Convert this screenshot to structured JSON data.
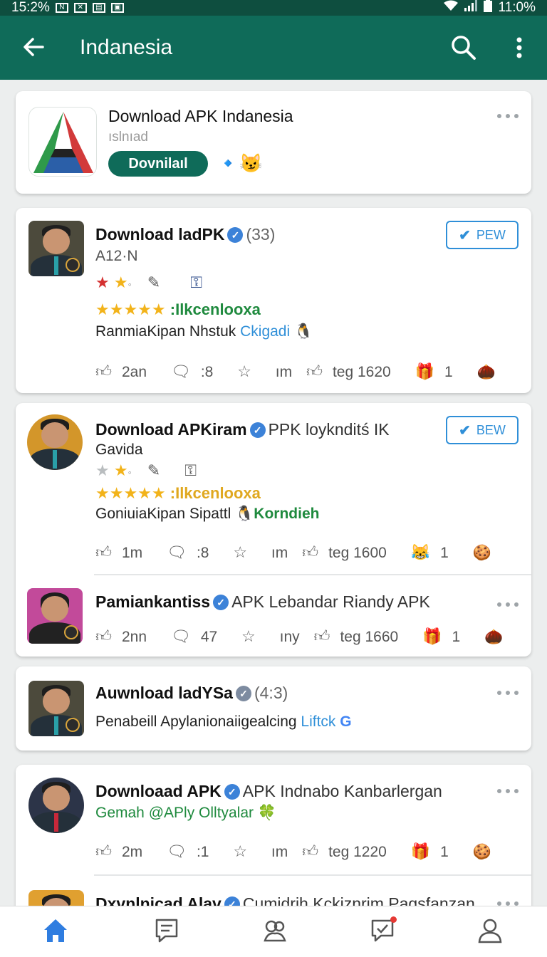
{
  "status_bar": {
    "time_left": "15:2%",
    "time_right": "11:0%",
    "icons": [
      "notification-n-icon",
      "notification-x-icon",
      "notification-book-icon",
      "notification-image-icon",
      "wifi-icon",
      "signal-icon",
      "battery-icon"
    ]
  },
  "app_bar": {
    "title": "Indanesia",
    "icons": [
      "back-arrow-icon",
      "search-icon",
      "more-vert-icon"
    ],
    "color": "#0f6b59"
  },
  "app_card": {
    "name": "Download APK Indanesia",
    "subtitle": "ıslnıad",
    "button_label": "Dovnilaıl"
  },
  "posts": [
    {
      "name": "Download ladPK",
      "count": "(33)",
      "subtitle": "A12·N",
      "follow_label": "PEW",
      "rating_text": ":Ilkcenlooxa",
      "body": "RanmiaKipan Nhstuk",
      "link": "Ckigadi",
      "likes": "2an",
      "comments": ":8",
      "views": "ım",
      "shares": "teg 1620",
      "gifts": "1"
    },
    {
      "name": "Download APKiram",
      "meta": "PPK loyknditś IK",
      "subtitle": "Gavida",
      "follow_label": "BEW",
      "rating_text": ":Ilkcenlooxa",
      "body": "GoniuiaKipan Sipattl",
      "link": "Korndieh",
      "likes": "1m",
      "comments": ":8",
      "views": "ım",
      "shares": "teg 1600",
      "gifts": "1"
    },
    {
      "name": "Pamiankantiss",
      "meta": "APK Lebandar Riandy APK",
      "likes": "2nn",
      "comments": "47",
      "views": "ıny",
      "shares": "teg 1660",
      "gifts": "1"
    },
    {
      "name": "Auwnload ladYSa",
      "count": "(4:3)",
      "body": "Penabeill Apylanionaiigealcing",
      "link": "Liftck"
    },
    {
      "name": "Downloaad APK",
      "meta": "APK Indnabo Kanbarlergan",
      "subtitle": "Gemah @APly Olltyalar",
      "likes": "2m",
      "comments": ":1",
      "views": "ım",
      "shares": "teg 1220",
      "gifts": "1"
    },
    {
      "name": "Dxvnlnicad Alav",
      "meta": "Cumidrih Kckiznrim Pagsfanzan"
    }
  ],
  "bottom_nav": {
    "items": [
      "home-icon",
      "messages-icon",
      "community-icon",
      "notifications-icon",
      "profile-icon"
    ],
    "active": "home-icon"
  }
}
